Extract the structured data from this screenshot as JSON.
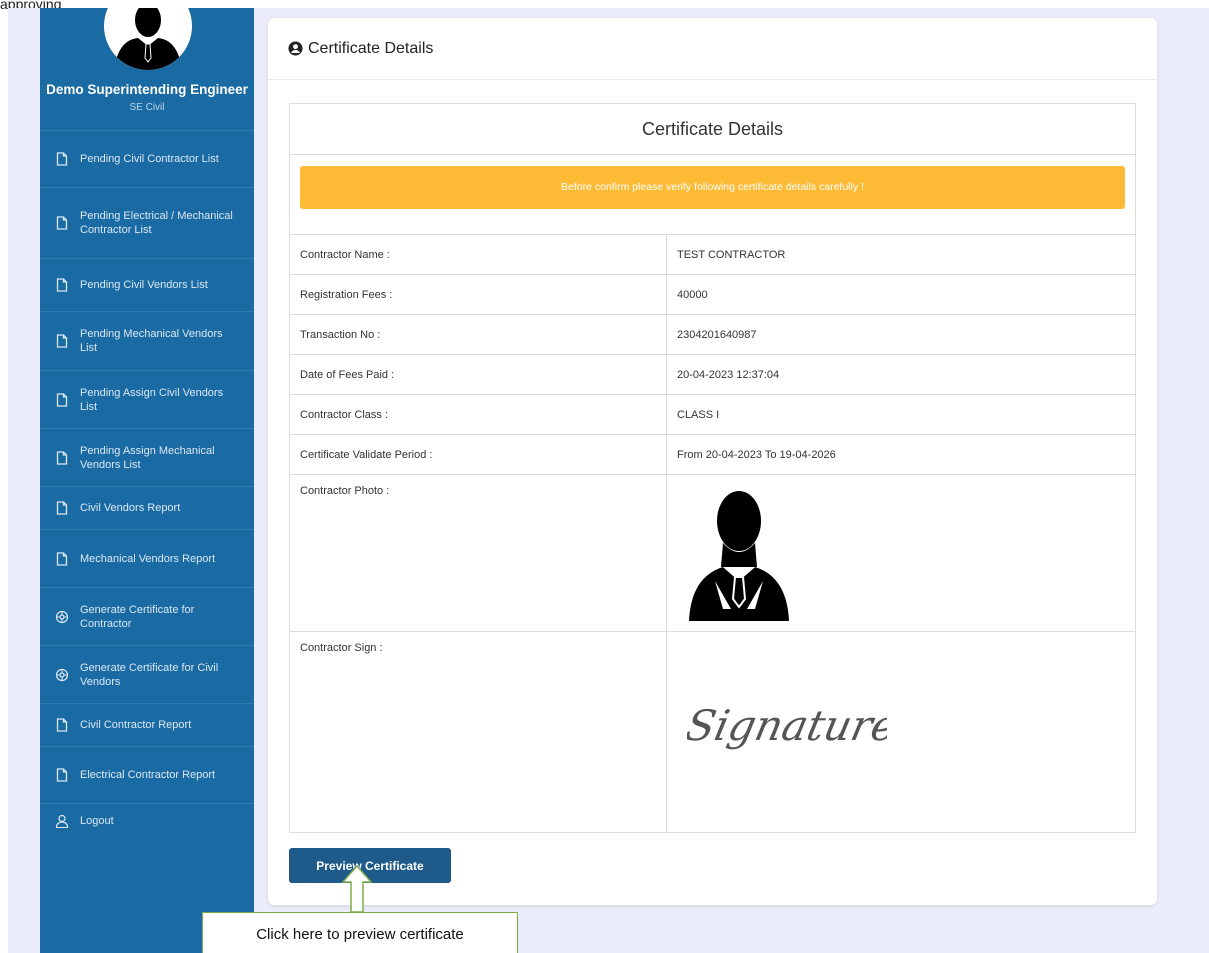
{
  "top_text": "approving",
  "sidebar": {
    "user_name": "Demo Superintending Engineer",
    "user_role": "SE Civil",
    "items": [
      {
        "label": "Pending Civil Contractor List",
        "icon": "file-icon"
      },
      {
        "label": "Pending Electrical / Mechanical Contractor List",
        "icon": "file-icon"
      },
      {
        "label": "Pending Civil Vendors List",
        "icon": "file-icon"
      },
      {
        "label": "Pending Mechanical Vendors List",
        "icon": "file-icon"
      },
      {
        "label": "Pending Assign Civil Vendors List",
        "icon": "file-icon"
      },
      {
        "label": "Pending Assign Mechanical Vendors List",
        "icon": "file-icon"
      },
      {
        "label": "Civil Vendors Report",
        "icon": "file-icon"
      },
      {
        "label": "Mechanical Vendors Report",
        "icon": "file-icon"
      },
      {
        "label": "Generate Certificate for Contractor",
        "icon": "gear-icon"
      },
      {
        "label": "Generate Certificate for Civil Vendors",
        "icon": "gear-icon"
      },
      {
        "label": "Civil Contractor Report",
        "icon": "file-icon"
      },
      {
        "label": "Electrical Contractor Report",
        "icon": "file-icon"
      }
    ],
    "logout_label": "Logout"
  },
  "card": {
    "header_title": "Certificate Details",
    "details_title": "Certificate Details",
    "alert_text": "Before confirm please verify following certificate details carefully !",
    "rows": [
      {
        "label": "Contractor Name :",
        "value": "TEST CONTRACTOR"
      },
      {
        "label": "Registration Fees :",
        "value": "40000"
      },
      {
        "label": "Transaction No :",
        "value": "2304201640987"
      },
      {
        "label": "Date of Fees Paid :",
        "value": "20-04-2023 12:37:04"
      },
      {
        "label": "Contractor Class :",
        "value": "CLASS I"
      },
      {
        "label": "Certificate Validate Period :",
        "value": "From 20-04-2023 To 19-04-2026"
      }
    ],
    "photo_label": "Contractor Photo :",
    "sign_label": "Contractor Sign :",
    "signature_text": "Signature",
    "preview_button": "Preview Certificate"
  },
  "callout": {
    "text": "Click here to preview certificate"
  },
  "colors": {
    "sidebar_bg": "#1a6aa3",
    "alert_bg": "#fdbb35",
    "button_bg": "#1e5a8a",
    "callout_border": "#7fad4b",
    "page_bg": "#ecedfb"
  }
}
